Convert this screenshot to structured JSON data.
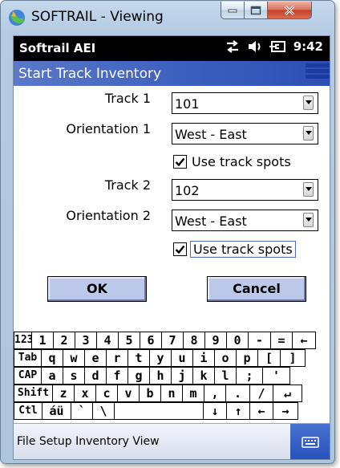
{
  "window": {
    "title": "SOFTRAIL - Viewing"
  },
  "statusbar": {
    "device_name": "Softrail AEI",
    "time": "9:42"
  },
  "header": {
    "title": "Start Track Inventory"
  },
  "form": {
    "track1_label": "Track 1",
    "track1_value": "101",
    "orientation1_label": "Orientation 1",
    "orientation1_value": "West - East",
    "use_spots1_label": "Use track spots",
    "use_spots1_checked": true,
    "track2_label": "Track 2",
    "track2_value": "102",
    "orientation2_label": "Orientation 2",
    "orientation2_value": "West - East",
    "use_spots2_label": "Use track spots",
    "use_spots2_checked": true,
    "ok_label": "OK",
    "cancel_label": "Cancel"
  },
  "keyboard": {
    "rows": [
      [
        "123",
        "1",
        "2",
        "3",
        "4",
        "5",
        "6",
        "7",
        "8",
        "9",
        "0",
        "-",
        "=",
        "←"
      ],
      [
        "Tab",
        "q",
        "w",
        "e",
        "r",
        "t",
        "y",
        "u",
        "i",
        "o",
        "p",
        "[",
        "]"
      ],
      [
        "CAP",
        "a",
        "s",
        "d",
        "f",
        "g",
        "h",
        "j",
        "k",
        "l",
        ";",
        "'"
      ],
      [
        "Shift",
        "z",
        "x",
        "c",
        "v",
        "b",
        "n",
        "m",
        ",",
        ".",
        "/",
        "↵"
      ],
      [
        "Ctl",
        "áü",
        "`",
        "\\",
        "",
        "↓",
        "↑",
        "←",
        "→"
      ]
    ]
  },
  "menu": {
    "text": "File Setup Inventory View"
  },
  "icons": {
    "app": "app-globe-icon",
    "sync": "sync-arrows-icon",
    "volume": "speaker-icon",
    "power": "battery-plug-icon",
    "sip": "keyboard-icon"
  },
  "colors": {
    "header": "#3c5fbe",
    "button": "#bcc9ea",
    "sip": "#2d5bc4"
  }
}
